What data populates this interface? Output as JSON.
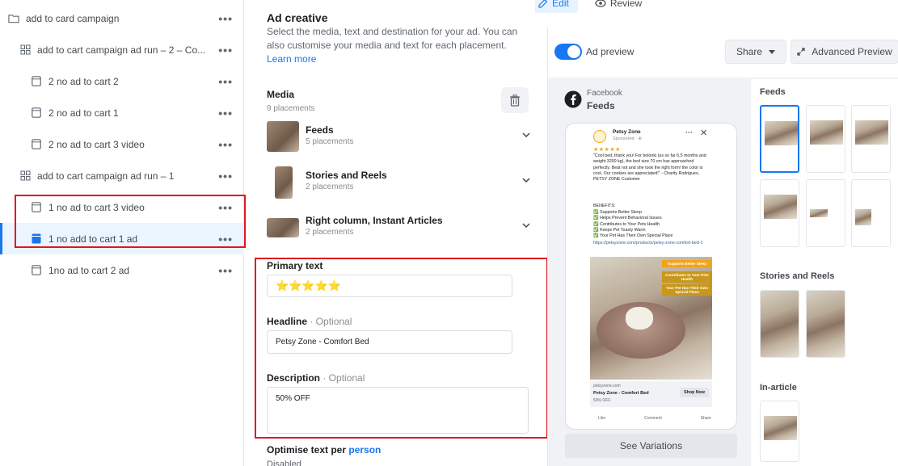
{
  "tree": {
    "items": [
      {
        "label": "add to card campaign",
        "icon": "folder-icon",
        "indent": 0
      },
      {
        "label": "add to cart campaign ad run – 2 – Co...",
        "icon": "grid-icon",
        "indent": 1
      },
      {
        "label": "2 no ad to cart 2",
        "icon": "ad-icon",
        "indent": 2
      },
      {
        "label": "2 no ad to cart 1",
        "icon": "ad-icon",
        "indent": 2
      },
      {
        "label": "2 no ad to cart 3 video",
        "icon": "ad-icon",
        "indent": 2
      },
      {
        "label": "add to cart campaign ad run – 1",
        "icon": "grid-icon",
        "indent": 1
      },
      {
        "label": "1 no ad to cart 3 video",
        "icon": "ad-icon",
        "indent": 2
      },
      {
        "label": "1 no add to cart 1 ad",
        "icon": "ad-icon-selected",
        "indent": 2
      },
      {
        "label": "1no ad to cart 2 ad",
        "icon": "ad-icon",
        "indent": 2
      }
    ],
    "more_label": "•••"
  },
  "tabs": {
    "edit": "Edit",
    "review": "Review"
  },
  "editor": {
    "section_title": "Ad creative",
    "description": "Select the media, text and destination for your ad. You can also customise your media and text for each placement.",
    "learn_more": "Learn more",
    "media_title": "Media",
    "media_count": "9 placements",
    "media_rows": [
      {
        "title": "Feeds",
        "sub": "5 placements"
      },
      {
        "title": "Stories and Reels",
        "sub": "2 placements"
      },
      {
        "title": "Right column, Instant Articles",
        "sub": "2 placements"
      }
    ],
    "primary_text_label": "Primary text",
    "primary_text_value": "⭐⭐⭐⭐⭐",
    "headline_label": "Headline",
    "headline_opt": " · Optional",
    "headline_value": "Petsy Zone - Comfort Bed",
    "description_label": "Description",
    "description_opt": " · Optional",
    "description_value": "50% OFF",
    "optimise_label_a": "Optimise text per ",
    "optimise_label_b": "person",
    "optimise_status": "Disabled"
  },
  "preview": {
    "ad_preview_label": "Ad preview",
    "share_label": "Share",
    "advanced_label": "Advanced Preview",
    "platform": "Facebook",
    "placement": "Feeds",
    "see_variations": "See Variations",
    "post": {
      "page_name": "Petsy Zone",
      "sponsored": "Sponsored · ⊕",
      "stars": "★★★★★",
      "review": "\"Cool bed, thank you! For bolonki (us so far 6,5 months and weight 3200 kg), the bed size 70 cm has approached perfectly. Beat not and she took the right form! the color is cool. Our cookies are appreciated!\" - Charity Rodrigues, PETSY ZONE Customer",
      "benefits_title": "BENEFITS:",
      "benefits": [
        "✅ Supports Better Sleep",
        "✅ Helps Prevent Behavioral Issues",
        "✅ Contributes to Your Pets Health",
        "✅ Keeps Pet Toasty Warm",
        "✅ Your Pet Has Their Own Special Place"
      ],
      "link": "https://petsyzone.com/products/petsy-zone-comfort-bed-1",
      "overlay": [
        "Supports Better Sleep",
        "Contributes to Your Pets Health",
        "Your Pet Has Their Own Special Place"
      ],
      "domain": "petsyzone.com",
      "headline": "Petsy Zone - Comfort Bed",
      "desc": "50% OFF",
      "cta": "Shop Now",
      "actions": [
        "Like",
        "Comment",
        "Share"
      ]
    },
    "feeds_title": "Feeds",
    "stories_title": "Stories and Reels",
    "inarticle_title": "In-article"
  },
  "colors": {
    "accent": "#1877f2",
    "highlight": "#e0161f",
    "overlay_orange": "#f0a41e"
  }
}
